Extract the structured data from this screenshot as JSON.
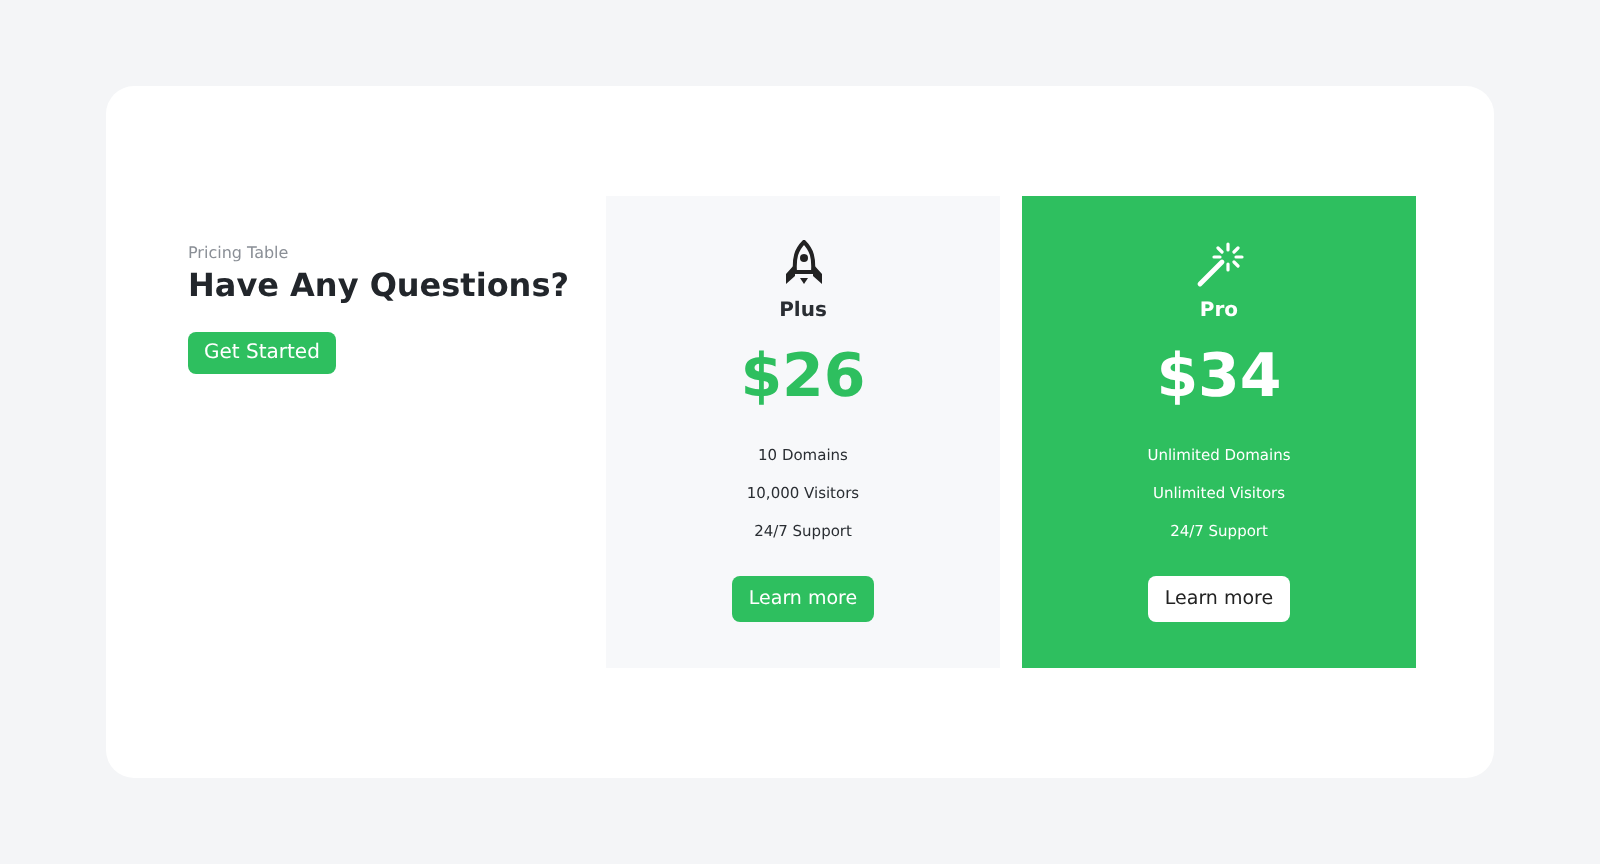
{
  "intro": {
    "eyebrow": "Pricing Table",
    "title": "Have Any Questions?",
    "button": "Get Started"
  },
  "plans": [
    {
      "kind": "rocket",
      "name": "Plus",
      "price": "$26",
      "features": [
        "10 Domains",
        "10,000 Visitors",
        "24/7 Support"
      ],
      "button": "Learn more",
      "highlighted": false
    },
    {
      "kind": "wand",
      "name": "Pro",
      "price": "$34",
      "features": [
        "Unlimited Domains",
        "Unlimited Visitors",
        "24/7 Support"
      ],
      "button": "Learn more",
      "highlighted": true
    }
  ]
}
